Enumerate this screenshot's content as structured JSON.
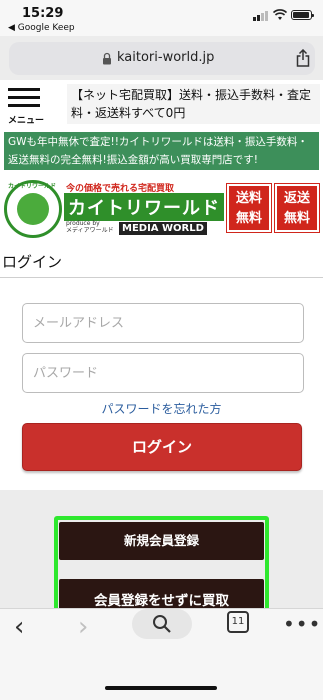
{
  "status_bar": {
    "time": "15:29",
    "back_app": "◀ Google Keep"
  },
  "browser": {
    "url": "kaitori-world.jp",
    "tabs_count": "11"
  },
  "header": {
    "menu_label": "メニュー",
    "promo": "【ネット宅配買取】送料・振込手数料・査定料・返送料すべて0円"
  },
  "notice": "GWも年中無休で査定!!カイトリワールドは送料・振込手数料・返送無料の完全無料!振込金額が高い買取専門店です!",
  "banner": {
    "logo_text": "カイトリワールド",
    "tagline": "今の価格で売れる宅配買取",
    "brand": "カイトリワールド",
    "produce_by": "produce by",
    "produce_sub": "メディアワールド",
    "media_world": "MEDIA WORLD",
    "badge1": "送料無料",
    "badge1_l1": "送料",
    "badge1_l2": "無料",
    "badge2_l1": "返送",
    "badge2_l2": "無料"
  },
  "login": {
    "title": "ログイン",
    "email_placeholder": "メールアドレス",
    "password_placeholder": "パスワード",
    "forgot": "パスワードを忘れた方",
    "button": "ログイン"
  },
  "actions": {
    "register": "新規会員登録",
    "buy_without_register": "会員登録をせずに買取"
  },
  "colors": {
    "notice_green": "#3d8f5a",
    "login_red": "#c9302c",
    "dark_button": "#2b1612",
    "highlight_green": "#2ee82e"
  }
}
